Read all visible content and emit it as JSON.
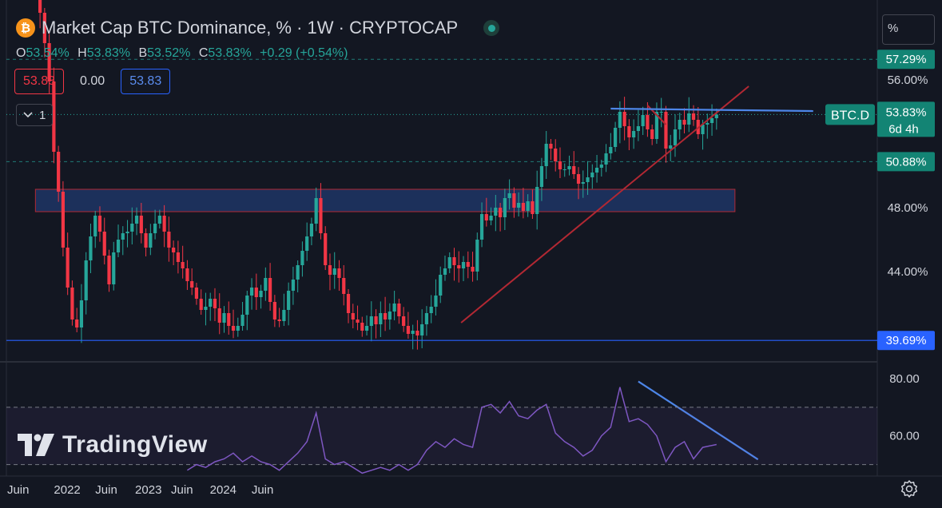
{
  "header": {
    "coin_glyph": "₿",
    "title": "Market Cap BTC Dominance, % · 1W · CRYPTOCAP"
  },
  "ohlc": {
    "o_label": "O",
    "o_value": "53.54%",
    "h_label": "H",
    "h_value": "53.83%",
    "l_label": "B",
    "l_value": "53.52%",
    "c_label": "C",
    "c_value": "53.83%",
    "change": "+0.29 (+0.54%)"
  },
  "indicator_row": {
    "left": "53.83",
    "middle": "0.00",
    "right": "53.83"
  },
  "collapse": {
    "count": "1"
  },
  "unit_button": {
    "label": "%"
  },
  "watermark": {
    "text": "TradingView"
  },
  "colors": {
    "up": "#26a69a",
    "down": "#f23645",
    "blue": "#2962ff",
    "trend": "#b22833",
    "rsi": "#7e57c2",
    "zone": "#1e3565"
  },
  "chart_data": [
    {
      "type": "candlestick",
      "symbol": "BTC.D",
      "ylim": [
        38.5,
        61
      ],
      "y_ticks": [
        "56.00%",
        "48.00%",
        "44.00%"
      ],
      "y_tick_values": [
        56,
        48,
        44
      ],
      "price_labels": [
        {
          "text": "57.29%",
          "value": 57.29,
          "style": "green"
        },
        {
          "text": "50.88%",
          "value": 50.88,
          "style": "green"
        },
        {
          "text": "39.69%",
          "value": 39.69,
          "style": "blue"
        }
      ],
      "current": {
        "symbol": "BTC.D",
        "text": "53.83%",
        "countdown": "6d 4h",
        "value": 53.83
      },
      "x_ticks": [
        "Juin",
        "2022",
        "Juin",
        "2023",
        "Juin",
        "2024",
        "Juin"
      ],
      "x_tick_t": [
        0.105,
        0.318,
        0.488,
        0.671,
        0.817,
        0.996,
        1.167
      ],
      "closes": [
        [
          0.0,
          70.5
        ],
        [
          0.02,
          70.0
        ],
        [
          0.04,
          70.1
        ],
        [
          0.06,
          67.3
        ],
        [
          0.08,
          69.8
        ],
        [
          0.1,
          68.4
        ],
        [
          0.12,
          67.4
        ],
        [
          0.14,
          67.3
        ],
        [
          0.16,
          66.4
        ],
        [
          0.18,
          62.5
        ],
        [
          0.2,
          60.2
        ],
        [
          0.22,
          58.3
        ],
        [
          0.24,
          55.9
        ],
        [
          0.26,
          51.5
        ],
        [
          0.28,
          49.0
        ],
        [
          0.3,
          45.5
        ],
        [
          0.32,
          43.0
        ],
        [
          0.34,
          41.0
        ],
        [
          0.36,
          40.5
        ],
        [
          0.38,
          42.2
        ],
        [
          0.4,
          44.7
        ],
        [
          0.42,
          46.2
        ],
        [
          0.44,
          47.5
        ],
        [
          0.46,
          46.5
        ],
        [
          0.48,
          45.0
        ],
        [
          0.5,
          43.2
        ],
        [
          0.52,
          45.2
        ],
        [
          0.54,
          46.0
        ],
        [
          0.56,
          46.4
        ],
        [
          0.58,
          46.5
        ],
        [
          0.6,
          47.0
        ],
        [
          0.62,
          47.5
        ],
        [
          0.64,
          46.4
        ],
        [
          0.66,
          45.5
        ],
        [
          0.68,
          46.4
        ],
        [
          0.7,
          47.0
        ],
        [
          0.72,
          47.5
        ],
        [
          0.74,
          46.5
        ],
        [
          0.76,
          45.5
        ],
        [
          0.78,
          45.2
        ],
        [
          0.8,
          44.6
        ],
        [
          0.82,
          44.2
        ],
        [
          0.84,
          43.4
        ],
        [
          0.86,
          43.0
        ],
        [
          0.88,
          42.3
        ],
        [
          0.9,
          41.6
        ],
        [
          0.92,
          41.8
        ],
        [
          0.94,
          42.3
        ],
        [
          0.96,
          41.7
        ],
        [
          0.98,
          40.8
        ],
        [
          1.0,
          41.4
        ],
        [
          1.02,
          40.6
        ],
        [
          1.04,
          40.3
        ],
        [
          1.06,
          40.6
        ],
        [
          1.08,
          41.3
        ],
        [
          1.1,
          42.5
        ],
        [
          1.12,
          43.0
        ],
        [
          1.14,
          42.4
        ],
        [
          1.16,
          42.8
        ],
        [
          1.18,
          43.6
        ],
        [
          1.2,
          42.1
        ],
        [
          1.22,
          41.0
        ],
        [
          1.24,
          40.9
        ],
        [
          1.26,
          41.6
        ],
        [
          1.28,
          42.8
        ],
        [
          1.3,
          43.5
        ],
        [
          1.32,
          44.4
        ],
        [
          1.34,
          45.3
        ],
        [
          1.36,
          46.2
        ],
        [
          1.38,
          47.0
        ],
        [
          1.4,
          48.6
        ],
        [
          1.42,
          46.4
        ],
        [
          1.44,
          44.4
        ],
        [
          1.46,
          43.8
        ],
        [
          1.48,
          44.2
        ],
        [
          1.5,
          43.6
        ],
        [
          1.52,
          42.6
        ],
        [
          1.54,
          41.4
        ],
        [
          1.56,
          41.0
        ],
        [
          1.58,
          40.8
        ],
        [
          1.6,
          40.3
        ],
        [
          1.62,
          40.6
        ],
        [
          1.64,
          41.2
        ],
        [
          1.66,
          40.7
        ],
        [
          1.68,
          41.4
        ],
        [
          1.7,
          41.0
        ],
        [
          1.72,
          41.5
        ],
        [
          1.74,
          42.0
        ],
        [
          1.76,
          41.2
        ],
        [
          1.78,
          40.6
        ],
        [
          1.8,
          40.1
        ],
        [
          1.82,
          40.3
        ],
        [
          1.84,
          40.0
        ],
        [
          1.86,
          40.7
        ],
        [
          1.88,
          41.4
        ],
        [
          1.9,
          41.8
        ],
        [
          1.92,
          42.5
        ],
        [
          1.94,
          43.8
        ],
        [
          1.96,
          44.2
        ],
        [
          1.98,
          44.9
        ],
        [
          2.0,
          44.4
        ],
        [
          2.02,
          44.2
        ],
        [
          2.04,
          44.6
        ],
        [
          2.06,
          44.3
        ],
        [
          2.08,
          44.0
        ],
        [
          2.1,
          46.0
        ],
        [
          2.12,
          47.6
        ],
        [
          2.14,
          47.2
        ],
        [
          2.16,
          47.5
        ],
        [
          2.18,
          48.0
        ],
        [
          2.2,
          47.4
        ],
        [
          2.22,
          48.6
        ],
        [
          2.24,
          48.9
        ],
        [
          2.26,
          48.0
        ],
        [
          2.28,
          48.3
        ],
        [
          2.3,
          47.8
        ],
        [
          2.32,
          48.4
        ],
        [
          2.34,
          47.6
        ],
        [
          2.36,
          49.3
        ],
        [
          2.38,
          50.6
        ],
        [
          2.4,
          52.0
        ],
        [
          2.42,
          51.7
        ],
        [
          2.44,
          50.9
        ],
        [
          2.46,
          50.4
        ],
        [
          2.48,
          50.4
        ],
        [
          2.5,
          50.6
        ],
        [
          2.52,
          50.1
        ],
        [
          2.54,
          49.5
        ],
        [
          2.56,
          49.6
        ],
        [
          2.58,
          49.9
        ],
        [
          2.6,
          50.2
        ],
        [
          2.62,
          50.5
        ],
        [
          2.64,
          50.7
        ],
        [
          2.66,
          51.4
        ],
        [
          2.68,
          51.8
        ],
        [
          2.7,
          53.0
        ],
        [
          2.72,
          54.0
        ],
        [
          2.74,
          53.1
        ],
        [
          2.76,
          52.4
        ],
        [
          2.78,
          52.8
        ],
        [
          2.8,
          53.1
        ],
        [
          2.82,
          53.8
        ],
        [
          2.84,
          52.9
        ],
        [
          2.86,
          52.3
        ],
        [
          2.88,
          54.0
        ],
        [
          2.9,
          54.0
        ],
        [
          2.92,
          51.7
        ],
        [
          2.94,
          51.9
        ],
        [
          2.96,
          52.9
        ],
        [
          2.98,
          53.5
        ],
        [
          3.0,
          53.2
        ],
        [
          3.02,
          53.9
        ],
        [
          3.04,
          53.5
        ],
        [
          3.06,
          52.6
        ],
        [
          3.08,
          53.2
        ],
        [
          3.1,
          53.3
        ],
        [
          3.12,
          53.6
        ],
        [
          3.14,
          53.83
        ]
      ]
    },
    {
      "type": "line",
      "name": "RSI",
      "ylim": [
        46,
        85
      ],
      "y_ticks": [
        "80.00",
        "60.00"
      ],
      "y_tick_values": [
        80,
        60
      ],
      "bands": [
        70,
        50
      ],
      "x": [
        0.84,
        0.88,
        0.92,
        0.96,
        1.0,
        1.04,
        1.08,
        1.12,
        1.16,
        1.2,
        1.24,
        1.28,
        1.32,
        1.36,
        1.4,
        1.44,
        1.48,
        1.52,
        1.56,
        1.6,
        1.64,
        1.68,
        1.72,
        1.76,
        1.8,
        1.84,
        1.88,
        1.92,
        1.96,
        2.0,
        2.04,
        2.08,
        2.12,
        2.16,
        2.2,
        2.24,
        2.28,
        2.32,
        2.36,
        2.4,
        2.44,
        2.48,
        2.52,
        2.56,
        2.6,
        2.64,
        2.68,
        2.72,
        2.76,
        2.8,
        2.84,
        2.88,
        2.92,
        2.96,
        3.0,
        3.04,
        3.08,
        3.14
      ],
      "values": [
        48,
        50,
        49,
        51,
        52,
        54,
        51,
        53,
        51,
        50,
        48,
        51,
        54,
        58,
        68,
        52,
        50,
        51,
        49,
        47,
        48,
        49,
        48,
        50,
        48,
        50,
        55,
        58,
        56,
        59,
        57,
        56,
        70,
        71,
        68,
        72,
        67,
        66,
        69,
        71,
        61,
        58,
        56,
        53,
        55,
        60,
        63,
        77,
        65,
        66,
        64,
        60,
        51,
        56,
        58,
        52,
        56,
        57
      ]
    }
  ]
}
